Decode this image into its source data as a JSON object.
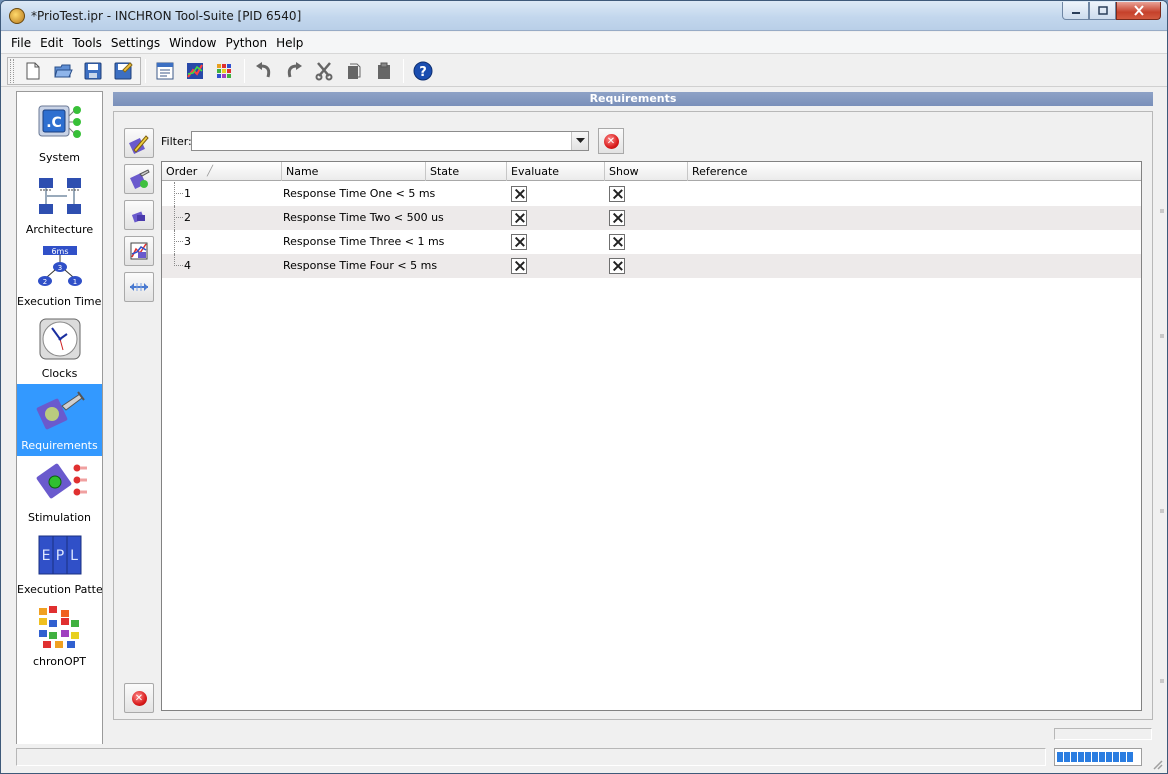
{
  "window": {
    "title": "*PrioTest.ipr - INCHRON Tool-Suite [PID 6540]",
    "controls": {
      "minimize": "minimize",
      "maximize": "maximize",
      "close": "close"
    }
  },
  "menu": [
    "File",
    "Edit",
    "Tools",
    "Settings",
    "Window",
    "Python",
    "Help"
  ],
  "toolbar": {
    "buttons": [
      "new-document",
      "open-folder",
      "save",
      "save-as",
      "properties",
      "chart",
      "chronopt-grid",
      "undo",
      "redo",
      "cut",
      "copy",
      "paste",
      "help"
    ]
  },
  "sidebar": {
    "items": [
      {
        "label": "System",
        "icon": "system-icon"
      },
      {
        "label": "Architecture",
        "icon": "architecture-icon"
      },
      {
        "label": "Execution Times",
        "icon": "execution-times-icon",
        "badges": [
          "6ms",
          "3",
          "2",
          "1"
        ]
      },
      {
        "label": "Clocks",
        "icon": "clock-icon"
      },
      {
        "label": "Requirements",
        "icon": "requirements-icon",
        "active": true
      },
      {
        "label": "Stimulation",
        "icon": "stimulation-icon"
      },
      {
        "label": "Execution Patterr",
        "icon": "execution-pattern-icon",
        "badges": [
          "E",
          "P",
          "L"
        ]
      },
      {
        "label": "chronOPT",
        "icon": "chronopt-icon"
      }
    ]
  },
  "requirements": {
    "header": "Requirements",
    "filter": {
      "label": "Filter:",
      "value": ""
    },
    "tools": [
      "edit-requirement",
      "add-requirement",
      "duplicate-requirement",
      "chart-requirement",
      "link-requirement",
      "delete-requirement"
    ],
    "columns": [
      "Order",
      "Name",
      "State",
      "Evaluate",
      "Show",
      "Reference"
    ],
    "rows": [
      {
        "order": "1",
        "name": "Response Time One < 5 ms",
        "state": "",
        "evaluate": true,
        "show": true,
        "reference": ""
      },
      {
        "order": "2",
        "name": "Response Time Two < 500 us",
        "state": "",
        "evaluate": true,
        "show": true,
        "reference": ""
      },
      {
        "order": "3",
        "name": "Response Time Three < 1 ms",
        "state": "",
        "evaluate": true,
        "show": true,
        "reference": ""
      },
      {
        "order": "4",
        "name": "Response Time Four < 5 ms",
        "state": "",
        "evaluate": true,
        "show": true,
        "reference": ""
      }
    ]
  },
  "colors": {
    "accent": "#3399ff",
    "header": "#8ea2c6",
    "row_alt": "#edeaea",
    "progress": "#2a7de1"
  }
}
